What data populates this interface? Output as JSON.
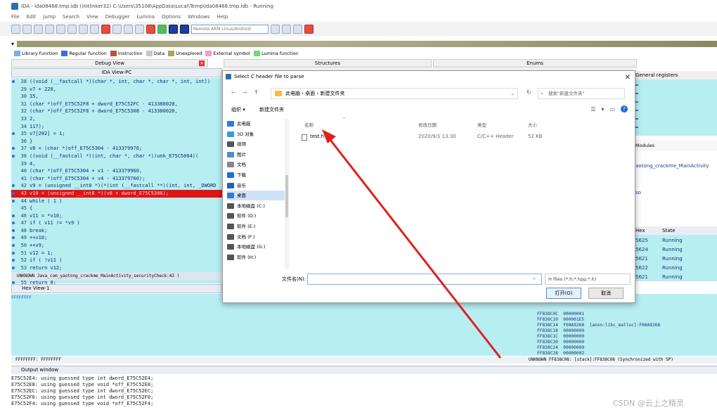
{
  "window": {
    "title": "IDA - ida08468.tmp.idb (initlinker32) C:\\Users\\35108\\AppData\\Local\\Temp\\ida08468.tmp.idb - Running"
  },
  "menu": [
    "File",
    "Edit",
    "Jump",
    "Search",
    "View",
    "Debugger",
    "Lumina",
    "Options",
    "Windows",
    "Help"
  ],
  "toolbar": {
    "debugger_select": "Remote ARM Linux/Android debugger"
  },
  "legend": [
    {
      "label": "Library function",
      "color": "#6fb5e8"
    },
    {
      "label": "Regular function",
      "color": "#3b6fd8"
    },
    {
      "label": "Instruction",
      "color": "#b8543d"
    },
    {
      "label": "Data",
      "color": "#c8c8c8"
    },
    {
      "label": "Unexplored",
      "color": "#a6a65a"
    },
    {
      "label": "External symbol",
      "color": "#f0a0c8"
    },
    {
      "label": "Lumina function",
      "color": "#6fd86f"
    }
  ],
  "panels": {
    "debug_view": "Debug View",
    "ida_view": "IDA View-PC",
    "structures": "Structures",
    "enums": "Enums",
    "registers": "General registers",
    "modules": "Modules",
    "hex_view": "Hex View-1",
    "output": "Output window"
  },
  "code": [
    {
      "ln": "28",
      "text": "((void (__fastcall *)(char *, int, char *, char *, int, int))",
      "dot": true
    },
    {
      "ln": "29",
      "text": "    v7 + 220,",
      "dot": false
    },
    {
      "ln": "30",
      "text": "    35,",
      "dot": false
    },
    {
      "ln": "31",
      "text": "    (char *)off_E75C52F8 + dword_E75C52FC - 413380020,",
      "dot": false
    },
    {
      "ln": "32",
      "text": "    (char *)off_E75C52F8 + dword_E75C5308 - 413380020,",
      "dot": false
    },
    {
      "ln": "33",
      "text": "    2,",
      "dot": false
    },
    {
      "ln": "34",
      "text": "    117);",
      "dot": false
    },
    {
      "ln": "35",
      "text": "  v7[202] = 1;",
      "dot": true
    },
    {
      "ln": "36",
      "text": "}",
      "dot": false
    },
    {
      "ln": "37",
      "text": "v8 = (char *)off_E75C5304 - 413379976;",
      "dot": true
    },
    {
      "ln": "38",
      "text": "((void (__fastcall *)(int, char *, char *))unk_E75C5004)(",
      "dot": true
    },
    {
      "ln": "39",
      "text": "  4,",
      "dot": false
    },
    {
      "ln": "40",
      "text": "  (char *)off_E75C5304 + v1 - 413379960,",
      "dot": false
    },
    {
      "ln": "41",
      "text": "  (char *)off_E75C5304 + v4 - 413379760);",
      "dot": false
    },
    {
      "ln": "42",
      "text": "v9 = (unsigned __int8 *)(*(int (__fastcall **)(int, int, _DWORD",
      "dot": true
    },
    {
      "ln": "43",
      "text": "v10 = (unsigned __int8 *)(v8 + dword_E75C5308);",
      "dot": true,
      "hl": true
    },
    {
      "ln": "44",
      "text": "while ( 1 )",
      "dot": true
    },
    {
      "ln": "45",
      "text": "{",
      "dot": false
    },
    {
      "ln": "46",
      "text": "  v11 = *v10;",
      "dot": true
    },
    {
      "ln": "47",
      "text": "  if ( v11 != *v9 )",
      "dot": true
    },
    {
      "ln": "48",
      "text": "    break;",
      "dot": true
    },
    {
      "ln": "49",
      "text": "  ++v10;",
      "dot": true
    },
    {
      "ln": "50",
      "text": "  ++v9;",
      "dot": true
    },
    {
      "ln": "51",
      "text": "  v12 = 1;",
      "dot": true
    },
    {
      "ln": "52",
      "text": "  if ( !v11 )",
      "dot": true
    },
    {
      "ln": "53",
      "text": "    return v12;",
      "dot": true
    },
    {
      "ln": "54",
      "text": "}",
      "dot": false
    },
    {
      "ln": "55",
      "text": "return 0;",
      "dot": true
    },
    {
      "ln": "56",
      "text": "}",
      "dot": true
    }
  ],
  "code_status": "UNKNOWN Java_com_yaotong_crackme_MainActivity_securityCheck:43 (",
  "hex": {
    "addr": "FFFFFFFF",
    "footer": "FFFFFFFF: FFFFFFFF"
  },
  "stack": [
    "FF838C0C  00000001",
    "FF838C10  000001E5",
    "FF838C14  F08A9268  [anon:libc_malloc]:F08A9268",
    "FF838C18  00000000",
    "FF838C1C  00000000",
    "FF838C20  00000000",
    "FF838C24  00000000",
    "FF838C28  00000002"
  ],
  "stack_status": "UNKNOWN FF838C08: [stack]:FF838C08 (Synchronized with SP)",
  "output": [
    "E75C52E4: using guessed type int dword_E75C52E4;",
    "E75C52E8: using guessed type void *off_E75C52E8;",
    "E75C52EC: using guessed type int dword_E75C52EC;",
    "E75C52F0: using guessed type int dword_E75C52F0;",
    "E75C52F4: using guessed type void *off_E75C52F4;"
  ],
  "right": {
    "modules_tab": "Modules",
    "jpath": "yaotong_crackme_MainActivity",
    "so": "so",
    "threads_header": [
      "Hex",
      "State"
    ],
    "threads": [
      {
        "hex": "5625",
        "state": "Running"
      },
      {
        "hex": "5624",
        "state": "Running"
      },
      {
        "hex": "5621",
        "state": "Running"
      },
      {
        "hex": "5622",
        "state": "Running"
      },
      {
        "hex": "5621",
        "state": "Running"
      }
    ]
  },
  "dialog": {
    "title": "Select C header file to parse",
    "address": "此电脑 › 桌面 › 新建文件夹",
    "search_placeholder": "搜索\"新建文件夹\"",
    "organize": "组织 ▾",
    "new_folder": "新建文件夹",
    "sidebar": [
      {
        "label": "此电脑",
        "color": "#2f7bd8"
      },
      {
        "label": "3D 对象",
        "color": "#3a9ad8"
      },
      {
        "label": "视频",
        "color": "#555"
      },
      {
        "label": "图片",
        "color": "#4a8fd0"
      },
      {
        "label": "文档",
        "color": "#888"
      },
      {
        "label": "下载",
        "color": "#1e6dd6"
      },
      {
        "label": "音乐",
        "color": "#2a5db0"
      },
      {
        "label": "桌面",
        "color": "#2f7bd8",
        "selected": true
      },
      {
        "label": "本地磁盘 (C:)",
        "color": "#555"
      },
      {
        "label": "软件 (D:)",
        "color": "#555"
      },
      {
        "label": "软件 (E:)",
        "color": "#555"
      },
      {
        "label": "文档 (F:)",
        "color": "#555"
      },
      {
        "label": "本地磁盘 (G:)",
        "color": "#555"
      },
      {
        "label": "软件 (H:)",
        "color": "#555"
      }
    ],
    "columns": [
      "名称",
      "修改日期",
      "类型",
      "大小"
    ],
    "file": {
      "name": "test.h",
      "date": "2020/9/1 13:30",
      "type": "C/C++ Header",
      "size": "52 KB"
    },
    "filename_label": "文件名(N):",
    "filename_value": "",
    "filter": "H files (*.h;*.hpp;*.h)",
    "open": "打开(O)",
    "cancel": "取消"
  },
  "arrow": {
    "color": "#e02020"
  },
  "watermark": "CSDN @云上之精灵"
}
